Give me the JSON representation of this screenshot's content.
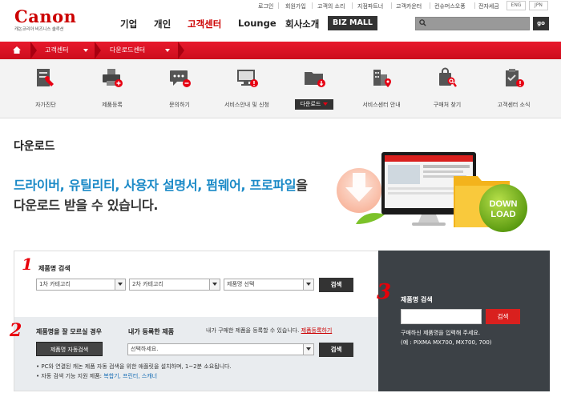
{
  "header": {
    "logo": "Canon",
    "logo_sub": "캐논코리아 비즈니스 솔루션",
    "nav": [
      {
        "label": "기업"
      },
      {
        "label": "개인"
      },
      {
        "label": "고객센터"
      },
      {
        "label": "Lounge"
      },
      {
        "label": "회사소개"
      }
    ],
    "bizmall": "BIZ MALL",
    "util_links": [
      "로그인",
      "회원가입",
      "고객의 소리",
      "지점파트너",
      "고객카운터",
      "컨슈머스오퐁",
      "전자세금"
    ],
    "lang": [
      "ENG",
      "JPN"
    ],
    "search_go": "go"
  },
  "breadcrumb": {
    "home": "홈",
    "items": [
      "고객센터",
      "다운로드센터"
    ]
  },
  "subnav": [
    {
      "label": "자가진단",
      "icon": "wrench-document-icon"
    },
    {
      "label": "제품등록",
      "icon": "printer-add-icon"
    },
    {
      "label": "문의하기",
      "icon": "chat-bubble-icon"
    },
    {
      "label": "서비스안내 및 신청",
      "icon": "monitor-alert-icon"
    },
    {
      "label": "다운로드",
      "icon": "folder-download-icon",
      "active": true
    },
    {
      "label": "서비스센터 안내",
      "icon": "building-pin-icon"
    },
    {
      "label": "구매처 찾기",
      "icon": "bag-search-icon"
    },
    {
      "label": "고객센터 소식",
      "icon": "clipboard-alert-icon"
    }
  ],
  "main": {
    "title": "다운로드",
    "headline_blue": "드라이버, 유틸리티, 사용자 설명서, 펌웨어, 프로파일",
    "headline_tail": "을",
    "headline2": "다운로드 받을 수 있습니다."
  },
  "hero": {
    "badge_line1": "DOWN",
    "badge_line2": "LOAD"
  },
  "search_left": {
    "marker1": "1",
    "marker2": "2",
    "title": "제품명 검색",
    "select1": "1차 카테고리",
    "select2": "2차 카테고리",
    "select3": "제품명 선택",
    "search_btn": "검색",
    "unknown_title": "제품명을 잘 모르실 경우",
    "auto_btn": "제품명 자동검색",
    "registered_title": "내가 등록한 제품",
    "registered_note": "내가 구매한 제품을 등록할 수 있습니다.",
    "register_link": "제품등록하기",
    "registered_select": "선택하세요.",
    "search_btn2": "검색",
    "note1": "• PC와 연결된 캐논 제품 자동 검색을 위한 애플릿을 설치하며, 1~2분 소요됩니다.",
    "note2_prefix": "• 자동 검색 기능 지원 제품: ",
    "note2_products": "복합기, 프린터, 스캐너"
  },
  "search_right": {
    "marker3": "3",
    "title": "제품명 검색",
    "button": "검색",
    "help1": "구매하신 제품명을 입력해 주세요.",
    "help2": "(예 : PIXMA MX700, MX700, 700)"
  }
}
